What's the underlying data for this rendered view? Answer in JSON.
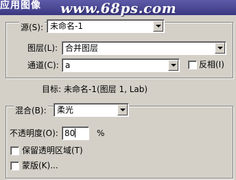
{
  "window": {
    "title": "应用图像",
    "watermark": "www.68ps.com"
  },
  "source": {
    "label": "源(S):",
    "value": "未命名-1",
    "layer_label": "图层(L):",
    "layer_value": "合并图层",
    "channel_label": "通道(C):",
    "channel_value": "a",
    "invert_label": "反相(I)",
    "invert_checked": false
  },
  "target": {
    "label": "目标:",
    "value": "未命名-1(图层 1, Lab)"
  },
  "blending": {
    "label": "混合(B):",
    "value": "柔光",
    "opacity_label": "不透明度(O):",
    "opacity_value": "80",
    "opacity_unit": "%",
    "preserve_label": "保留透明区域(T)",
    "preserve_checked": false,
    "mask_label": "蒙版(K)...",
    "mask_checked": false
  }
}
